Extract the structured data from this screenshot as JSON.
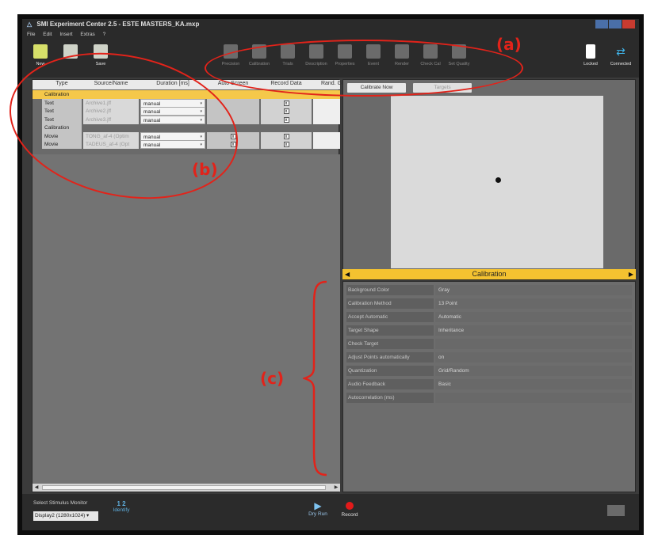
{
  "window": {
    "title": "SMI Experiment Center 2.5 - ESTE MASTERS_KA.mxp",
    "menu": [
      "File",
      "Edit",
      "Insert",
      "Extras",
      "?"
    ]
  },
  "toolbar": {
    "new_label": "New",
    "open_label": "",
    "save_label": "Save",
    "group": [
      "Precision",
      "Calibration",
      "Trials",
      "Description",
      "Properties",
      "Event",
      "Render",
      "Check Cal",
      "Set Quality"
    ],
    "locked_label": "Locked",
    "connected_label": "Connected"
  },
  "table": {
    "headers": [
      "Type",
      "Source/Name",
      "Duration [ms]",
      "Auto Screen",
      "Record Data",
      "Rand. Group"
    ],
    "rows": [
      {
        "type": "Calibration",
        "source": "",
        "duration": "",
        "auto": "",
        "record": "",
        "rand": "",
        "style": "hl"
      },
      {
        "type": "Text",
        "source": "Archive1.jff",
        "duration": "manual",
        "auto": "",
        "record": "x",
        "rand": "",
        "style": "norm"
      },
      {
        "type": "Text",
        "source": "Archive2.jff",
        "duration": "manual",
        "auto": "",
        "record": "x",
        "rand": "",
        "style": "norm"
      },
      {
        "type": "Text",
        "source": "Archive3.jff",
        "duration": "manual",
        "auto": "",
        "record": "x",
        "rand": "",
        "style": "norm"
      },
      {
        "type": "Calibration",
        "source": "",
        "duration": "",
        "auto": "",
        "record": "",
        "rand": "",
        "style": "sep"
      },
      {
        "type": "Movie",
        "source": "TONG_af-4 (Optim",
        "duration": "manual",
        "auto": "x",
        "record": "x",
        "rand": "",
        "style": "norm"
      },
      {
        "type": "Movie",
        "source": "TADEUS_af-4 (Opt",
        "duration": "manual",
        "auto": "x",
        "record": "x",
        "rand": "",
        "style": "norm"
      }
    ]
  },
  "preview": {
    "calibrate_now": "Calibrate Now",
    "second_tab": "Targets",
    "bar_label": "Calibration"
  },
  "properties": [
    {
      "label": "Background Color",
      "value": "Gray"
    },
    {
      "label": "Calibration Method",
      "value": "13 Point"
    },
    {
      "label": "Accept Automatic",
      "value": "Automatic"
    },
    {
      "label": "Target Shape",
      "value": "Inheritance"
    },
    {
      "label": "Check Target",
      "value": ""
    },
    {
      "label": "Adjust Points automatically",
      "value": "on"
    },
    {
      "label": "Quantization",
      "value": "Grid/Random"
    },
    {
      "label": "Audio Feedback",
      "value": "Basic"
    },
    {
      "label": "Autocorrelation (ms)",
      "value": ""
    }
  ],
  "bottom": {
    "stimulus_label": "Select Stimulus Monitor",
    "monitor_value": "Display2 (1280x1024)",
    "identify_icon": "1 2",
    "identify_label": "Identify",
    "dryrun_label": "Dry Run",
    "record_label": "Record"
  },
  "annotations": {
    "a": "(a)",
    "b": "(b)",
    "c": "(c)"
  }
}
